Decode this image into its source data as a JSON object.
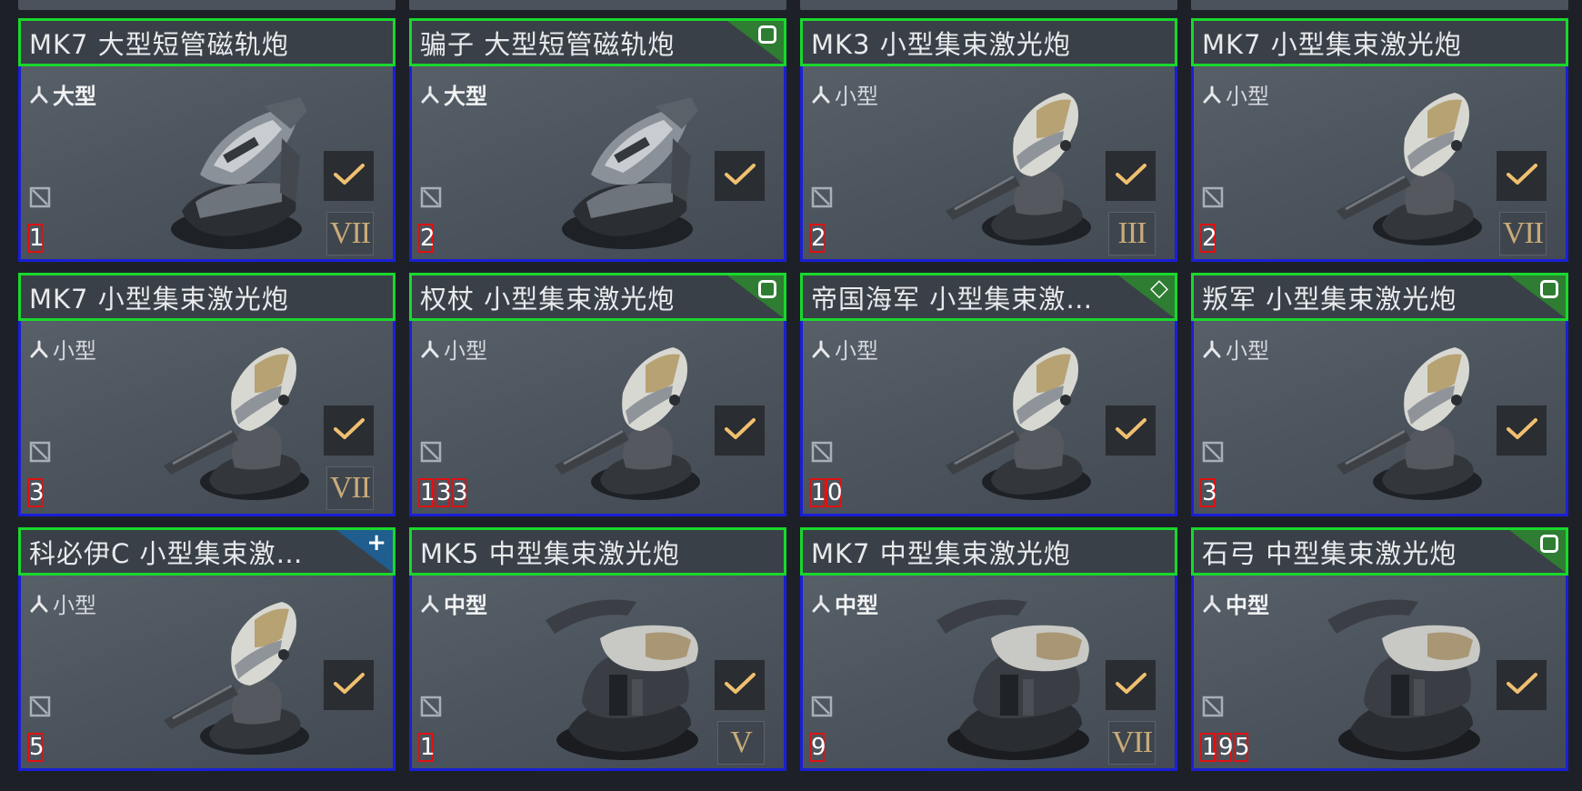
{
  "cards": [
    {
      "title": "MK7 大型短管磁轨炮",
      "size": "大型",
      "size_bold": true,
      "weapon": "railgun",
      "count": "1",
      "tier": "VII",
      "corner": null
    },
    {
      "title": "骗子 大型短管磁轨炮",
      "size": "大型",
      "size_bold": true,
      "weapon": "railgun",
      "count": "2",
      "tier": null,
      "corner": "square-green"
    },
    {
      "title": "MK3 小型集束激光炮",
      "size": "小型",
      "size_bold": false,
      "weapon": "laser-small",
      "count": "2",
      "tier": "III",
      "corner": null
    },
    {
      "title": "MK7 小型集束激光炮",
      "size": "小型",
      "size_bold": false,
      "weapon": "laser-small",
      "count": "2",
      "tier": "VII",
      "corner": null
    },
    {
      "title": "MK7 小型集束激光炮",
      "size": "小型",
      "size_bold": false,
      "weapon": "laser-small",
      "count": "3",
      "tier": "VII",
      "corner": null
    },
    {
      "title": "权杖 小型集束激光炮",
      "size": "小型",
      "size_bold": false,
      "weapon": "laser-small",
      "count": "133",
      "tier": null,
      "corner": "square-green"
    },
    {
      "title": "帝国海军 小型集束激…",
      "size": "小型",
      "size_bold": false,
      "weapon": "laser-small",
      "count": "10",
      "tier": null,
      "corner": "diamond-green"
    },
    {
      "title": "叛军 小型集束激光炮",
      "size": "小型",
      "size_bold": false,
      "weapon": "laser-small",
      "count": "3",
      "tier": null,
      "corner": "square-green"
    },
    {
      "title": "科必伊C 小型集束激…",
      "size": "小型",
      "size_bold": false,
      "weapon": "laser-small",
      "count": "5",
      "tier": null,
      "corner": "plus-blue"
    },
    {
      "title": "MK5 中型集束激光炮",
      "size": "中型",
      "size_bold": true,
      "weapon": "laser-medium",
      "count": "1",
      "tier": "V",
      "corner": null
    },
    {
      "title": "MK7 中型集束激光炮",
      "size": "中型",
      "size_bold": true,
      "weapon": "laser-medium",
      "count": "9",
      "tier": "VII",
      "corner": null
    },
    {
      "title": "石弓 中型集束激光炮",
      "size": "中型",
      "size_bold": true,
      "weapon": "laser-medium",
      "count": "195",
      "tier": null,
      "corner": "square-green"
    }
  ],
  "icons": {
    "size": "turret-size-icon",
    "check": "checkmark-icon",
    "no": "no-entry-icon"
  },
  "colors": {
    "card_border": "#1a1fd6",
    "header_border": "#19d82d",
    "check": "#f0c070",
    "count_border": "#e01010"
  }
}
